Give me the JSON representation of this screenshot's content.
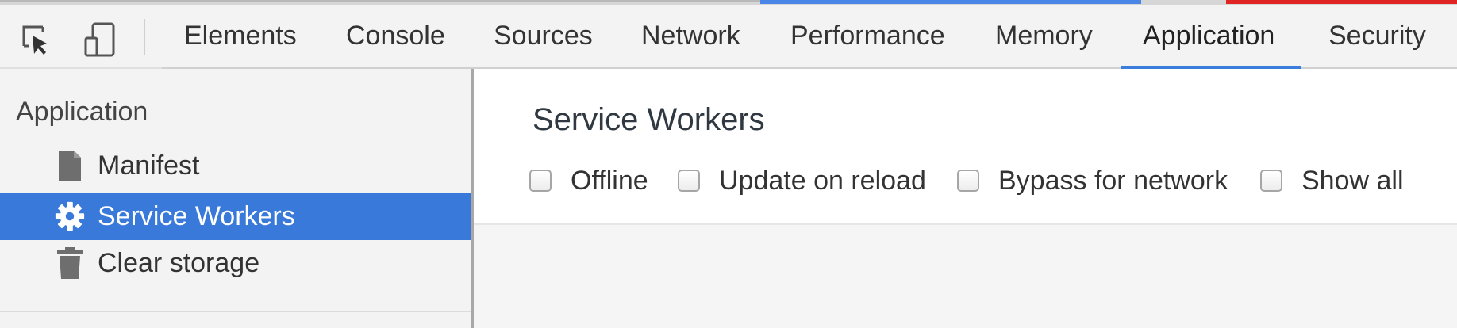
{
  "toolbar": {
    "inspect_icon": "inspect-element-icon",
    "device_icon": "device-toolbar-icon",
    "tabs": [
      {
        "label": "Elements"
      },
      {
        "label": "Console"
      },
      {
        "label": "Sources"
      },
      {
        "label": "Network"
      },
      {
        "label": "Performance"
      },
      {
        "label": "Memory"
      },
      {
        "label": "Application",
        "active": true
      },
      {
        "label": "Security"
      }
    ]
  },
  "sidebar": {
    "section_title": "Application",
    "items": [
      {
        "label": "Manifest",
        "icon": "document-icon"
      },
      {
        "label": "Service Workers",
        "icon": "gear-icon",
        "selected": true
      },
      {
        "label": "Clear storage",
        "icon": "trash-icon"
      }
    ]
  },
  "main": {
    "title": "Service Workers",
    "options": [
      {
        "label": "Offline",
        "checked": false
      },
      {
        "label": "Update on reload",
        "checked": false
      },
      {
        "label": "Bypass for network",
        "checked": false
      },
      {
        "label": "Show all",
        "checked": false
      }
    ]
  },
  "colors": {
    "accent": "#3879d9",
    "toolbar_bg": "#f3f3f3",
    "top_strip_blue": "#4a86e8",
    "top_strip_red": "#e02424"
  }
}
